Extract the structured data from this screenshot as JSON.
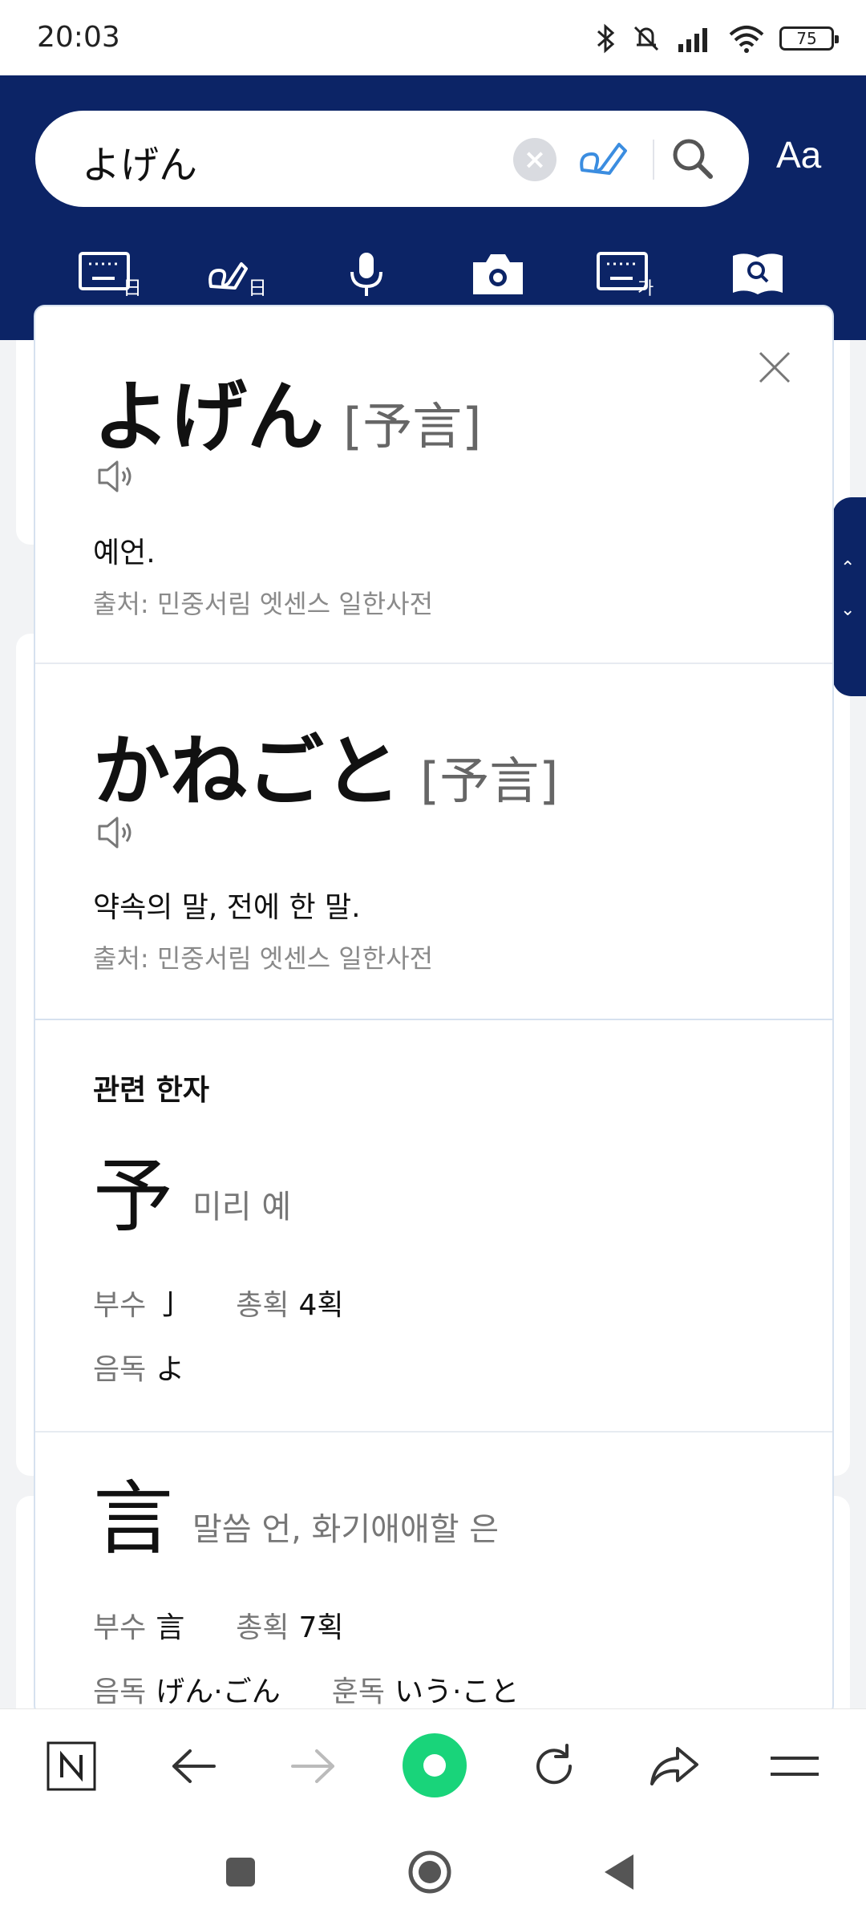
{
  "status": {
    "time": "20:03",
    "battery": "75"
  },
  "search": {
    "query": "よげん",
    "font_label": "Aa"
  },
  "results": [
    {
      "word": "よげん",
      "kanji": "[予言]",
      "meaning": "예언.",
      "source": "출처: 민중서림 엣센스 일한사전"
    },
    {
      "word": "かねごと",
      "kanji": "[予言]",
      "meaning": "약속의 말, 전에 한 말.",
      "source": "출처: 민중서림 엣센스 일한사전"
    }
  ],
  "related": {
    "title": "관련 한자",
    "items": [
      {
        "char": "予",
        "meaning": "미리 예",
        "radical_label": "부수",
        "radical": "亅",
        "strokes_label": "총획",
        "strokes": "4획",
        "on_label": "음독",
        "on": "よ",
        "kun_label": "",
        "kun": ""
      },
      {
        "char": "言",
        "meaning": "말씀 언, 화기애애할 은",
        "radical_label": "부수",
        "radical": "言",
        "strokes_label": "총획",
        "strokes": "7획",
        "on_label": "음독",
        "on": "げん·ごん",
        "kun_label": "훈독",
        "kun": "いう·こと"
      }
    ]
  },
  "colors": {
    "brand_navy": "#0c2466",
    "accent_green": "#19d47a",
    "hand_blue": "#3b8de0"
  }
}
